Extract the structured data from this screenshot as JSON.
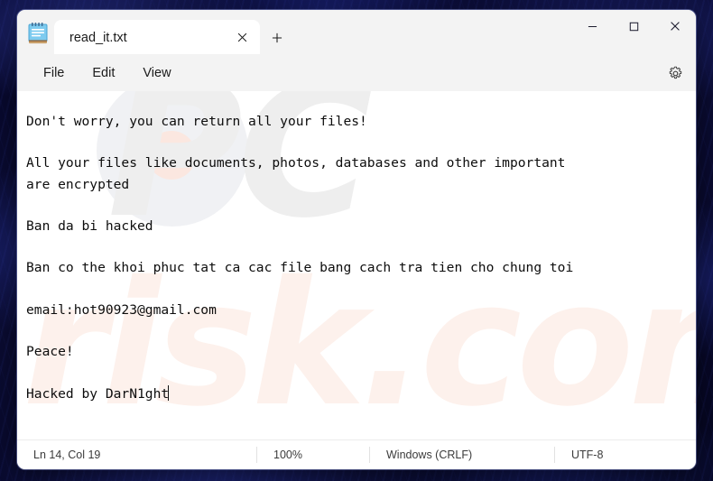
{
  "window": {
    "app_icon": "notepad-icon",
    "controls": {
      "minimize": "minimize-icon",
      "maximize": "maximize-icon",
      "close": "close-icon"
    }
  },
  "tabs": [
    {
      "title": "read_it.txt",
      "close_icon": "close-icon",
      "active": true
    }
  ],
  "new_tab": {
    "icon": "plus-icon",
    "label": "+"
  },
  "menubar": {
    "items": [
      {
        "label": "File"
      },
      {
        "label": "Edit"
      },
      {
        "label": "View"
      }
    ],
    "settings_icon": "gear-icon"
  },
  "editor": {
    "watermark_primary": "PC",
    "watermark_secondary": "risk.com",
    "lines": [
      "Don't worry, you can return all your files!",
      "",
      "All your files like documents, photos, databases and other important",
      "are encrypted",
      "",
      "Ban da bi hacked",
      "",
      "Ban co the khoi phuc tat ca cac file bang cach tra tien cho chung toi",
      "",
      "email:hot90923@gmail.com",
      "",
      "Peace!",
      "",
      "Hacked by DarN1ght"
    ]
  },
  "statusbar": {
    "position": "Ln 14, Col 19",
    "zoom": "100%",
    "line_endings": "Windows (CRLF)",
    "encoding": "UTF-8"
  },
  "colors": {
    "window_chrome": "#f3f3f3",
    "editor_bg": "#ffffff",
    "text": "#0d0d0d",
    "desktop": "#0a0b2e",
    "icon_blue": "#79c8ea"
  }
}
